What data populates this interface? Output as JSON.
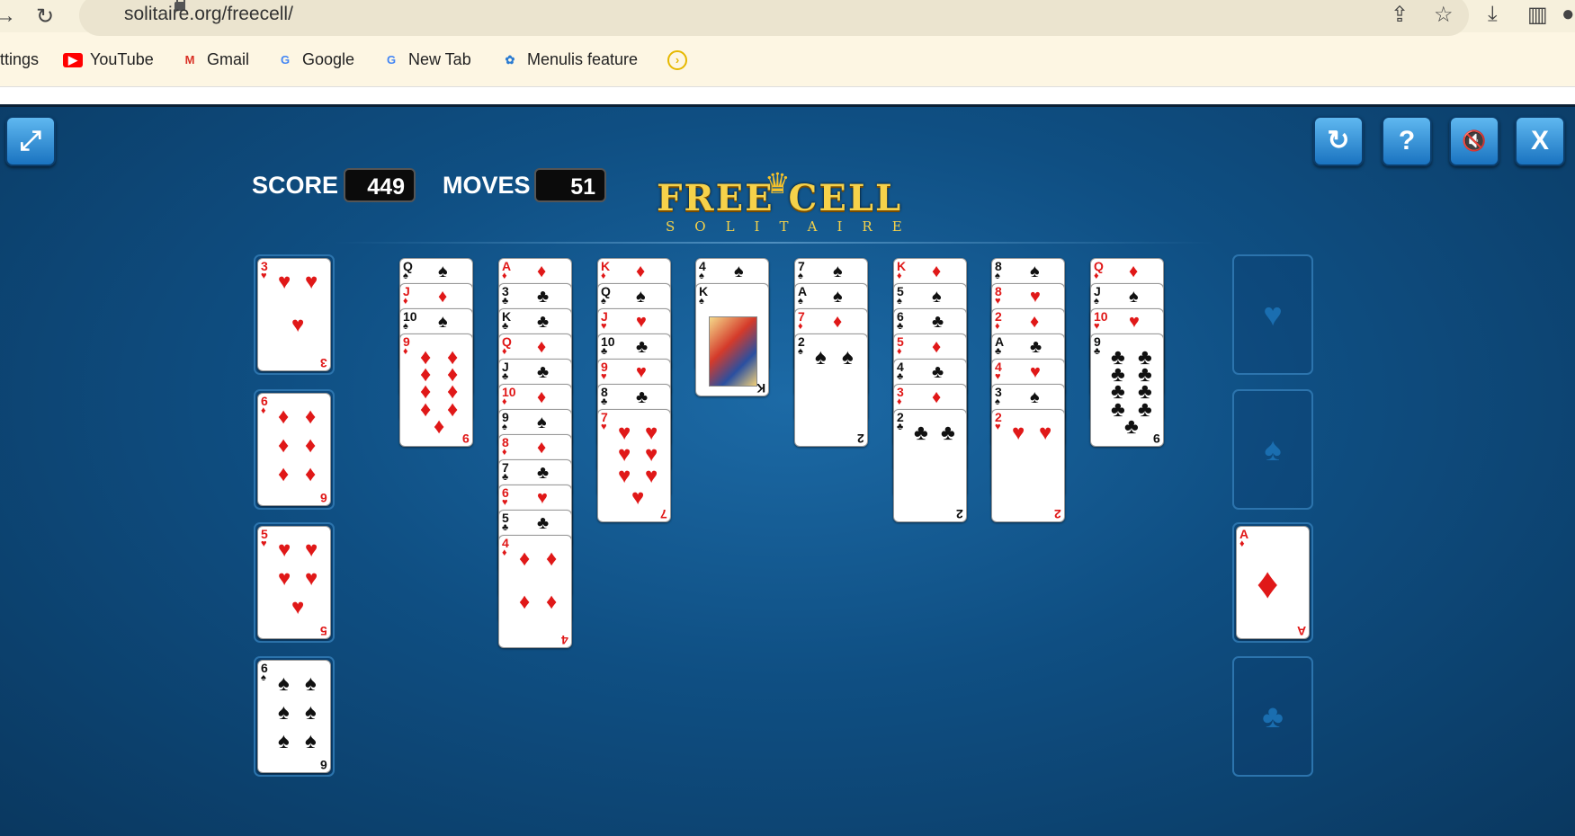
{
  "browser": {
    "url": "solitaire.org/freecell/",
    "bookmarks": [
      {
        "label": "ttings"
      },
      {
        "label": "YouTube"
      },
      {
        "label": "Gmail"
      },
      {
        "label": "Google"
      },
      {
        "label": "New Tab"
      },
      {
        "label": "Menulis feature"
      }
    ]
  },
  "game": {
    "score_label": "SCORE",
    "score": "449",
    "moves_label": "MOVES",
    "moves": "51",
    "logo_main": "FREE CELL",
    "logo_sub": "SOLITAIRE",
    "free_cells": [
      {
        "rank": "3",
        "suit": "♥",
        "color": "red"
      },
      {
        "rank": "6",
        "suit": "♦",
        "color": "red"
      },
      {
        "rank": "5",
        "suit": "♥",
        "color": "red"
      },
      {
        "rank": "6",
        "suit": "♠",
        "color": "black"
      }
    ],
    "foundations": [
      {
        "suit": "♥",
        "card": null
      },
      {
        "suit": "♠",
        "card": null
      },
      {
        "suit": "♦",
        "card": {
          "rank": "A",
          "suit": "♦",
          "color": "red"
        }
      },
      {
        "suit": "♣",
        "card": null
      }
    ],
    "tableau": [
      [
        [
          "Q",
          "♠"
        ],
        [
          "J",
          "♦"
        ],
        [
          "10",
          "♠"
        ],
        [
          "9",
          "♦"
        ]
      ],
      [
        [
          "A",
          "♦"
        ],
        [
          "3",
          "♣"
        ],
        [
          "K",
          "♣"
        ],
        [
          "Q",
          "♦"
        ],
        [
          "J",
          "♣"
        ],
        [
          "10",
          "♦"
        ],
        [
          "9",
          "♠"
        ],
        [
          "8",
          "♦"
        ],
        [
          "7",
          "♣"
        ],
        [
          "6",
          "♥"
        ],
        [
          "5",
          "♣"
        ],
        [
          "4",
          "♦"
        ]
      ],
      [
        [
          "K",
          "♦"
        ],
        [
          "Q",
          "♠"
        ],
        [
          "J",
          "♥"
        ],
        [
          "10",
          "♣"
        ],
        [
          "9",
          "♥"
        ],
        [
          "8",
          "♣"
        ],
        [
          "7",
          "♥"
        ]
      ],
      [
        [
          "4",
          "♠"
        ],
        [
          "K",
          "♠"
        ]
      ],
      [
        [
          "7",
          "♠"
        ],
        [
          "A",
          "♠"
        ],
        [
          "7",
          "♦"
        ],
        [
          "2",
          "♠"
        ]
      ],
      [
        [
          "K",
          "♦"
        ],
        [
          "5",
          "♠"
        ],
        [
          "6",
          "♣"
        ],
        [
          "5",
          "♦"
        ],
        [
          "4",
          "♣"
        ],
        [
          "3",
          "♦"
        ],
        [
          "2",
          "♣"
        ]
      ],
      [
        [
          "8",
          "♠"
        ],
        [
          "8",
          "♥"
        ],
        [
          "2",
          "♦"
        ],
        [
          "A",
          "♣"
        ],
        [
          "4",
          "♥"
        ],
        [
          "3",
          "♠"
        ],
        [
          "2",
          "♥"
        ]
      ],
      [
        [
          "Q",
          "♦"
        ],
        [
          "J",
          "♠"
        ],
        [
          "10",
          "♥"
        ],
        [
          "9",
          "♣"
        ]
      ]
    ]
  }
}
